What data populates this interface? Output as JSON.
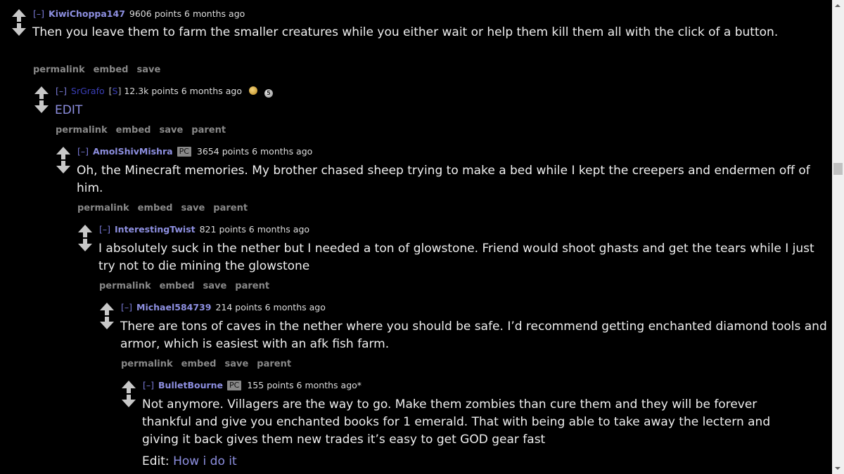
{
  "comments": [
    {
      "expand": "[–]",
      "author": "KiwiChoppa147",
      "score_text": "9606 points 6 months ago",
      "body": "Then you leave them to farm the smaller creatures while you either wait or help them kill them all with the click of a button.",
      "actions": [
        "permalink",
        "embed",
        "save"
      ]
    },
    {
      "expand": "[–]",
      "author": "SrGrafo",
      "submitter_mark": "S",
      "score_text": "12.3k points 6 months ago",
      "awards": [
        "gold-award-icon",
        "silver-award-icon"
      ],
      "silver_count": "5",
      "body": "EDIT",
      "actions": [
        "permalink",
        "embed",
        "save",
        "parent"
      ]
    },
    {
      "expand": "[–]",
      "author": "AmolShivMishra",
      "flair": "PC",
      "score_text": "3654 points 6 months ago",
      "body": "Oh, the Minecraft memories. My brother chased sheep trying to make a bed while I kept the creepers and endermen off of him.",
      "actions": [
        "permalink",
        "embed",
        "save",
        "parent"
      ]
    },
    {
      "expand": "[–]",
      "author": "InterestingTwist",
      "score_text": "821 points 6 months ago",
      "body": "I absolutely suck in the nether but I needed a ton of glowstone. Friend would shoot ghasts and get the tears while I just try not to die mining the glowstone",
      "actions": [
        "permalink",
        "embed",
        "save",
        "parent"
      ]
    },
    {
      "expand": "[–]",
      "author": "Michael584739",
      "score_text": "214 points 6 months ago",
      "body": "There are tons of caves in the nether where you should be safe. I’d recommend getting enchanted diamond tools and armor, which is easiest with an afk fish farm.",
      "actions": [
        "permalink",
        "embed",
        "save",
        "parent"
      ]
    },
    {
      "expand": "[–]",
      "author": "BulletBourne",
      "flair": "PC",
      "score_text": "155 points 6 months ago*",
      "body": "Not anymore. Villagers are the way to go. Make them zombies than cure them and they will be forever thankful and give you enchanted books for 1 emerald. That with being able to take away the lectern and giving it back gives them new trades it’s easy to get GOD gear fast",
      "edit_prefix": "Edit:",
      "edit_link": "How i do it"
    }
  ],
  "colors": {
    "background": "#000000",
    "author": "#8d8fe0",
    "body_text": "#eeeeee",
    "action_text": "#888888"
  }
}
